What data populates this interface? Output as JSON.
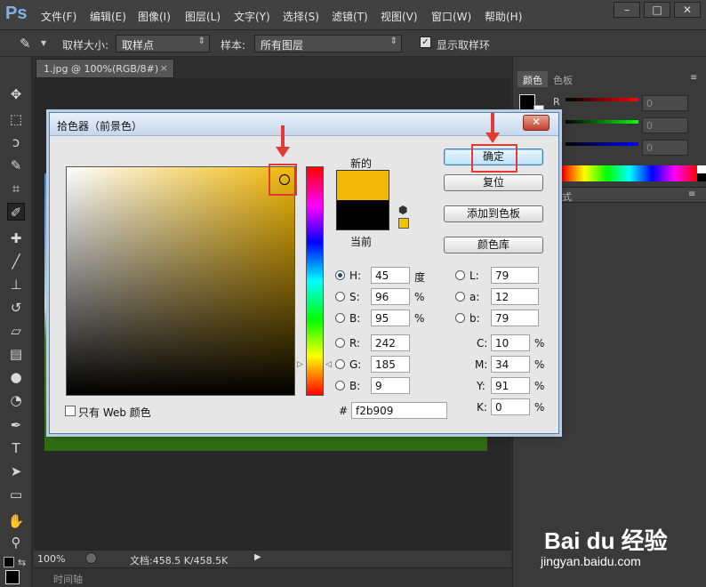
{
  "app": {
    "logo": "Ps"
  },
  "menu": [
    "文件(F)",
    "编辑(E)",
    "图像(I)",
    "图层(L)",
    "文字(Y)",
    "选择(S)",
    "滤镜(T)",
    "视图(V)",
    "窗口(W)",
    "帮助(H)"
  ],
  "window_controls": {
    "minimize": "–",
    "maximize": "□",
    "close": "✕"
  },
  "options": {
    "sample_size_label": "取样大小:",
    "sample_size_value": "取样点",
    "sample_label": "样本:",
    "sample_value": "所有图层",
    "show_ring_label": "显示取样环",
    "show_ring_checked": true
  },
  "document": {
    "tab_title": "1.jpg @ 100%(RGB/8#)",
    "tab_close": "×",
    "zoom": "100%",
    "doc_info": "文档:458.5 K/458.5K",
    "timeline_label": "时间轴"
  },
  "panels": {
    "tab_color": "颜色",
    "tab_swatches": "色板",
    "channel_r": "R",
    "r_value": "0",
    "g_value": "0",
    "b_value": "0",
    "styles_tab_fragment": "式"
  },
  "dialog": {
    "title": "拾色器（前景色）",
    "close": "✕",
    "label_new": "新的",
    "label_current": "当前",
    "new_color": "#f2b909",
    "current_color": "#000000",
    "buttons": {
      "ok": "确定",
      "reset": "复位",
      "add_to_swatches": "添加到色板",
      "color_libraries": "颜色库"
    },
    "hsb": {
      "h_label": "H:",
      "h_value": "45",
      "h_unit": "度",
      "s_label": "S:",
      "s_value": "96",
      "s_unit": "%",
      "b_label": "B:",
      "b_value": "95",
      "b_unit": "%"
    },
    "rgb": {
      "r_label": "R:",
      "r_value": "242",
      "g_label": "G:",
      "g_value": "185",
      "b_label": "B:",
      "b_value": "9"
    },
    "lab": {
      "l_label": "L:",
      "l_value": "79",
      "a_label": "a:",
      "a_value": "12",
      "b_label": "b:",
      "b_value": "79"
    },
    "cmyk": {
      "c_label": "C:",
      "c_value": "10",
      "c_unit": "%",
      "m_label": "M:",
      "m_value": "34",
      "m_unit": "%",
      "y_label": "Y:",
      "y_value": "91",
      "y_unit": "%",
      "k_label": "K:",
      "k_value": "0",
      "k_unit": "%"
    },
    "hex_label": "#",
    "hex_value": "f2b909",
    "web_only_label": "只有 Web 颜色"
  },
  "watermark": {
    "main": "Bai du 经验",
    "sub": "jingyan.baidu.com"
  }
}
